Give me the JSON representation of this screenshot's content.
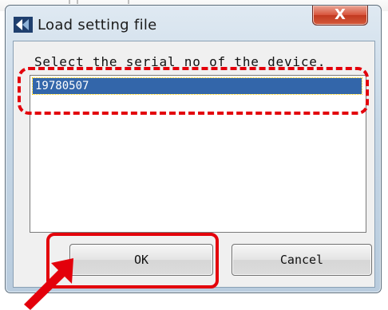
{
  "window": {
    "title": "Load setting file",
    "close_label": "X"
  },
  "dialog": {
    "prompt": "Select the serial no of the device.",
    "devices": [
      "19780507"
    ],
    "selected_index": 0
  },
  "buttons": {
    "ok_label": "OK",
    "cancel_label": "Cancel"
  },
  "annotations": {
    "color": "#e3000b"
  },
  "icons": {
    "app": "app-logo-icon",
    "close": "close-icon",
    "pointer": "pointer-arrow-icon"
  }
}
